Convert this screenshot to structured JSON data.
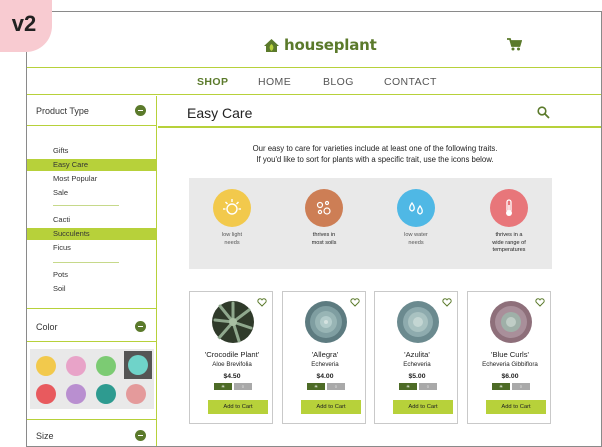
{
  "version_badge": "v2",
  "brand": {
    "name": "houseplant",
    "color": "#5b7a2b",
    "accent": "#b7d13a"
  },
  "nav": {
    "items": [
      "SHOP",
      "HOME",
      "BLOG",
      "CONTACT"
    ],
    "active": "SHOP"
  },
  "sidebar": {
    "product_type": {
      "title": "Product Type",
      "groups": [
        [
          "Gifts",
          "Easy Care",
          "Most Popular",
          "Sale"
        ],
        [
          "Cacti",
          "Succulents",
          "Ficus"
        ],
        [
          "Pots",
          "Soil"
        ]
      ],
      "selected": [
        "Easy Care",
        "Succulents"
      ]
    },
    "color": {
      "title": "Color",
      "swatches": [
        "#f2c94c",
        "#e8a3c8",
        "#7ccb73",
        "#6fd3c9",
        "#e85a5e",
        "#b98fd0",
        "#2e9b90",
        "#e49a9b"
      ],
      "selected": "#6fd3c9"
    },
    "size": {
      "title": "Size"
    }
  },
  "main": {
    "title": "Easy Care",
    "intro_line1": "Our easy to care for varieties include at least one  of the following traits.",
    "intro_line2": "If you'd like to sort for plants with a specific trait, use the icons below."
  },
  "traits": [
    {
      "icon": "sun-icon",
      "color": "#f2c94c",
      "label1": "low light",
      "label2": "needs",
      "label3": ""
    },
    {
      "icon": "soil-icon",
      "color": "#cd7e55",
      "label1": "thrives in",
      "label2": "most soils",
      "label3": ""
    },
    {
      "icon": "water-icon",
      "color": "#4fb8e5",
      "label1": "low water",
      "label2": "needs",
      "label3": ""
    },
    {
      "icon": "thermometer-icon",
      "color": "#e8767a",
      "label1": "thrives in a",
      "label2": "wide range of",
      "label3": "temperatures"
    }
  ],
  "products": [
    {
      "name": "'Crocodile Plant'",
      "scientific": "Aloe Brevifolia",
      "price": "$4.50",
      "tags": [
        "☀",
        "○"
      ],
      "button": "Add to Cart"
    },
    {
      "name": "'Allegra'",
      "scientific": "Echeveria",
      "price": "$4.00",
      "tags": [
        "☀",
        "○"
      ],
      "button": "Add to Cart"
    },
    {
      "name": "'Azulita'",
      "scientific": "Echeveria",
      "price": "$5.00",
      "tags": [
        "☀",
        "○"
      ],
      "button": "Add to Cart"
    },
    {
      "name": "'Blue Curls'",
      "scientific": "Echeveria Gibbiflora",
      "price": "$6.00",
      "tags": [
        "☀",
        "○"
      ],
      "button": "Add to Cart"
    }
  ]
}
